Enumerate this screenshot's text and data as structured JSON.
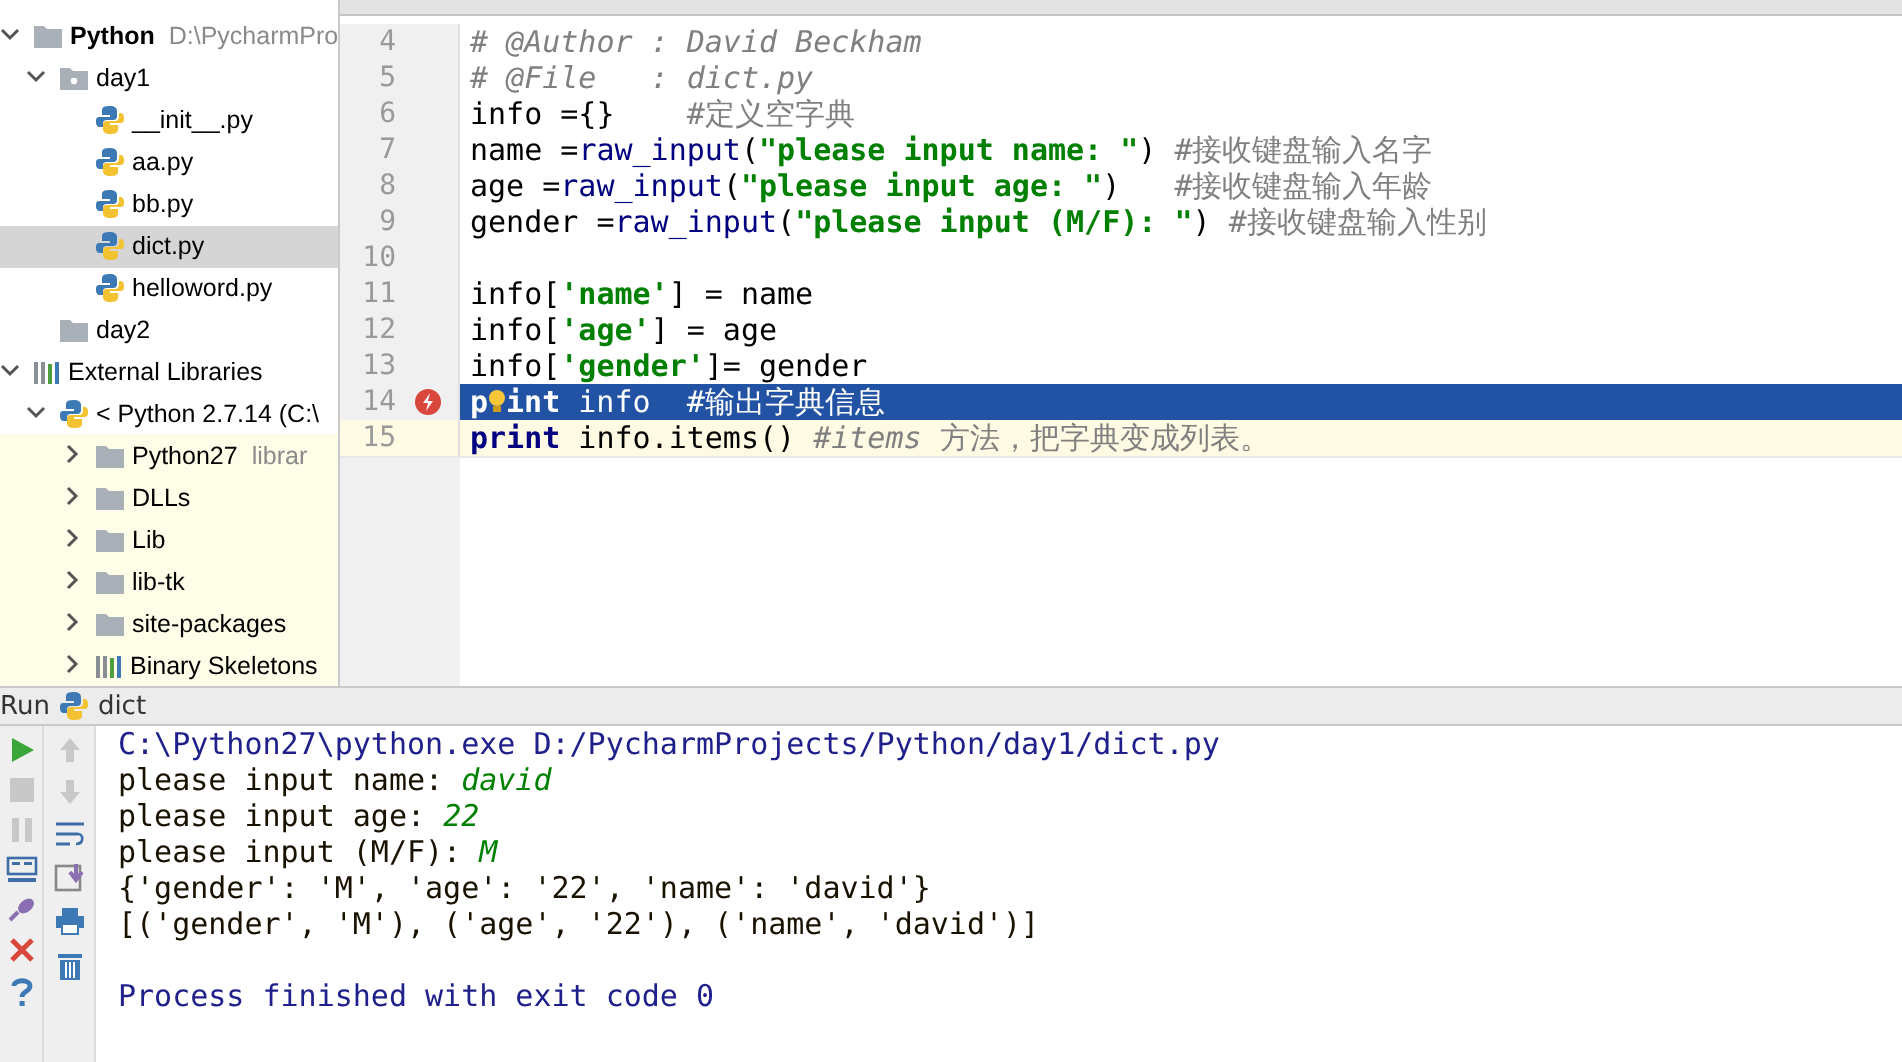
{
  "project_tree": [
    {
      "label": "Python",
      "kind": "folder",
      "bold": true,
      "note": "D:\\PycharmPro",
      "expanded": true,
      "selected": false,
      "children": [
        {
          "label": "day1",
          "kind": "package",
          "expanded": true,
          "selected": false,
          "children": [
            {
              "label": "__init__.py",
              "kind": "file",
              "selected": false
            },
            {
              "label": "aa.py",
              "kind": "file",
              "selected": false
            },
            {
              "label": "bb.py",
              "kind": "file",
              "selected": false
            },
            {
              "label": "dict.py",
              "kind": "file",
              "selected": true
            },
            {
              "label": "helloword.py",
              "kind": "file",
              "selected": false
            }
          ]
        },
        {
          "label": "day2",
          "kind": "folder",
          "selected": false
        }
      ]
    },
    {
      "label": "External Libraries",
      "kind": "libraries",
      "expanded": true,
      "selected": false,
      "children": [
        {
          "label": "< Python 2.7.14 (C:\\",
          "kind": "sdk",
          "expanded": true,
          "selected": false,
          "children": [
            {
              "label": "Python27",
              "kind": "library-folder",
              "note": "librar",
              "expanded": false,
              "selected": false
            },
            {
              "label": "DLLs",
              "kind": "library-folder",
              "expanded": false,
              "selected": false
            },
            {
              "label": "Lib",
              "kind": "library-folder",
              "expanded": false,
              "selected": false
            },
            {
              "label": "lib-tk",
              "kind": "library-folder",
              "expanded": false,
              "selected": false
            },
            {
              "label": "site-packages",
              "kind": "library-folder",
              "expanded": false,
              "selected": false
            },
            {
              "label": "Binary Skeletons",
              "kind": "libraries",
              "expanded": false,
              "selected": false
            }
          ]
        }
      ]
    }
  ],
  "editor": {
    "lines": [
      {
        "number": "4",
        "selected": false,
        "current": false,
        "breakpoint": false,
        "tokens": [
          {
            "text": "# @Author : David Beckham",
            "kind": "comment-italic"
          }
        ]
      },
      {
        "number": "5",
        "selected": false,
        "current": false,
        "breakpoint": false,
        "tokens": [
          {
            "text": "# @File   : dict.py",
            "kind": "comment-italic"
          }
        ]
      },
      {
        "number": "6",
        "selected": false,
        "current": false,
        "breakpoint": false,
        "tokens": [
          {
            "text": "info ={}",
            "kind": "plain"
          },
          {
            "text": "    #定义空字典",
            "kind": "comment"
          }
        ]
      },
      {
        "number": "7",
        "selected": false,
        "current": false,
        "breakpoint": false,
        "tokens": [
          {
            "text": "name =",
            "kind": "plain"
          },
          {
            "text": "raw_input",
            "kind": "builtin"
          },
          {
            "text": "(",
            "kind": "plain"
          },
          {
            "text": "\"please input name: \"",
            "kind": "string"
          },
          {
            "text": ") ",
            "kind": "plain"
          },
          {
            "text": "#接收键盘输入名字",
            "kind": "comment"
          }
        ]
      },
      {
        "number": "8",
        "selected": false,
        "current": false,
        "breakpoint": false,
        "tokens": [
          {
            "text": "age =",
            "kind": "plain"
          },
          {
            "text": "raw_input",
            "kind": "builtin"
          },
          {
            "text": "(",
            "kind": "plain"
          },
          {
            "text": "\"please input age: \"",
            "kind": "string"
          },
          {
            "text": ")   ",
            "kind": "plain"
          },
          {
            "text": "#接收键盘输入年龄",
            "kind": "comment"
          }
        ]
      },
      {
        "number": "9",
        "selected": false,
        "current": false,
        "breakpoint": false,
        "tokens": [
          {
            "text": "gender =",
            "kind": "plain"
          },
          {
            "text": "raw_input",
            "kind": "builtin"
          },
          {
            "text": "(",
            "kind": "plain"
          },
          {
            "text": "\"please input (M/F): \"",
            "kind": "string"
          },
          {
            "text": ") ",
            "kind": "plain"
          },
          {
            "text": "#接收键盘输入性别",
            "kind": "comment"
          }
        ]
      },
      {
        "number": "10",
        "selected": false,
        "current": false,
        "breakpoint": false
      },
      {
        "number": "11",
        "selected": false,
        "current": false,
        "breakpoint": false,
        "tokens": [
          {
            "text": "info[",
            "kind": "plain"
          },
          {
            "text": "'name'",
            "kind": "string"
          },
          {
            "text": "] = name",
            "kind": "plain"
          }
        ]
      },
      {
        "number": "12",
        "selected": false,
        "current": false,
        "breakpoint": false,
        "tokens": [
          {
            "text": "info[",
            "kind": "plain"
          },
          {
            "text": "'age'",
            "kind": "string"
          },
          {
            "text": "] = age",
            "kind": "plain"
          }
        ]
      },
      {
        "number": "13",
        "selected": false,
        "current": false,
        "breakpoint": false,
        "tokens": [
          {
            "text": "info[",
            "kind": "plain"
          },
          {
            "text": "'gender'",
            "kind": "string"
          },
          {
            "text": "]= gender",
            "kind": "plain"
          }
        ]
      },
      {
        "number": "14",
        "selected": true,
        "current": false,
        "breakpoint": true,
        "tokens": [
          {
            "text": "p",
            "kind": "keyword"
          },
          {
            "kind": "bulb"
          },
          {
            "text": "int",
            "kind": "keyword"
          },
          {
            "text": " info  ",
            "kind": "plain"
          },
          {
            "text": "#输出字典信息",
            "kind": "comment"
          }
        ]
      },
      {
        "number": "15",
        "selected": false,
        "current": true,
        "breakpoint": false,
        "tokens": [
          {
            "text": "print",
            "kind": "keyword"
          },
          {
            "text": " info.items() ",
            "kind": "plain"
          },
          {
            "text": "#items",
            "kind": "comment-italic"
          },
          {
            "text": " 方法，把字典变成列表。",
            "kind": "comment"
          }
        ]
      }
    ]
  },
  "run_panel": {
    "label": "Run",
    "config": "dict",
    "console": [
      {
        "blank_before": false,
        "segments": [
          {
            "text": "C:\\Python27\\python.exe D:/PycharmProjects/Python/day1/dict.py",
            "kind": "system"
          }
        ]
      },
      {
        "blank_before": false,
        "segments": [
          {
            "text": "please input name: ",
            "kind": "output"
          },
          {
            "text": "david",
            "kind": "input"
          }
        ]
      },
      {
        "blank_before": false,
        "segments": [
          {
            "text": "please input age: ",
            "kind": "output"
          },
          {
            "text": "22",
            "kind": "input"
          }
        ]
      },
      {
        "blank_before": false,
        "segments": [
          {
            "text": "please input (M/F): ",
            "kind": "output"
          },
          {
            "text": "M",
            "kind": "input"
          }
        ]
      },
      {
        "blank_before": false,
        "segments": [
          {
            "text": "{'gender': 'M', 'age': '22', 'name': 'david'}",
            "kind": "output"
          }
        ]
      },
      {
        "blank_before": false,
        "segments": [
          {
            "text": "[('gender', 'M'), ('age', '22'), ('name', 'david')]",
            "kind": "output"
          }
        ]
      },
      {
        "blank_before": true,
        "segments": [
          {
            "text": "Process finished with exit code 0",
            "kind": "system"
          }
        ]
      }
    ]
  }
}
